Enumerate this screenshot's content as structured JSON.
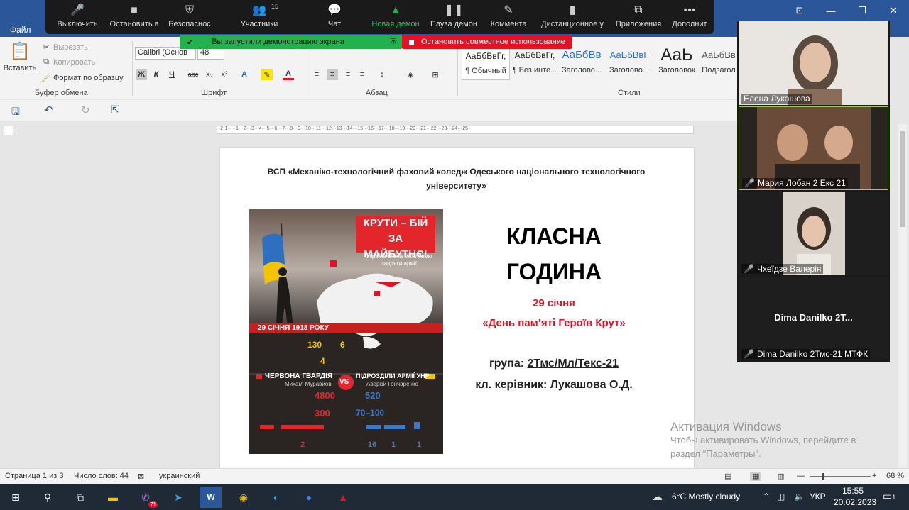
{
  "ribbon": {
    "file_tab": "Файл",
    "clipboard": {
      "paste": "Вставить",
      "cut": "Вырезать",
      "copy": "Копировать",
      "format_painter": "Формат по образцу",
      "label": "Буфер обмена"
    },
    "font": {
      "name": "Calibri (Основ",
      "size": "48",
      "label": "Шрифт",
      "bold": "Ж",
      "italic": "К",
      "underline": "Ч",
      "strike": "abc",
      "sub": "x₂",
      "sup": "x²"
    },
    "paragraph": {
      "label": "Абзац"
    },
    "styles": {
      "label": "Стили",
      "items": [
        {
          "preview": "АаБбВвГг,",
          "name": "¶ Обычный"
        },
        {
          "preview": "АаБбВвГг,",
          "name": "¶ Без инте..."
        },
        {
          "preview": "АаБбВв",
          "name": "Заголово..."
        },
        {
          "preview": "АаБбВвГ",
          "name": "Заголово..."
        },
        {
          "preview": "АаЬ",
          "name": "Заголовок"
        },
        {
          "preview": "АаБбВв",
          "name": "Подзагол"
        }
      ]
    }
  },
  "zoom": {
    "toolbar": [
      {
        "icon": "mic-icon",
        "glyph": "🎤",
        "label": "Выключить"
      },
      {
        "icon": "video-icon",
        "glyph": "■",
        "label": "Остановить в"
      },
      {
        "icon": "shield-icon",
        "glyph": "⛨",
        "label": "Безопаснос"
      },
      {
        "icon": "participants-icon",
        "glyph": "👥",
        "label": "Участники",
        "count": "15"
      },
      {
        "icon": "chat-icon",
        "glyph": "💬",
        "label": "Чат"
      },
      {
        "icon": "share-icon",
        "glyph": "▲",
        "label": "Новая демон"
      },
      {
        "icon": "pause-icon",
        "glyph": "❚❚",
        "label": "Пауза демон"
      },
      {
        "icon": "pen-icon",
        "glyph": "✎",
        "label": "Коммента"
      },
      {
        "icon": "remote-icon",
        "glyph": "▮",
        "label": "Дистанционное у"
      },
      {
        "icon": "apps-icon",
        "glyph": "⧉",
        "label": "Приложения"
      },
      {
        "icon": "more-icon",
        "glyph": "•••",
        "label": "Дополнит"
      }
    ],
    "share_notice": "Вы запустили демонстрацию экрана",
    "stop_share": "Остановить совместное использование",
    "participants": [
      {
        "name": "Елена Лукашова",
        "muted": false
      },
      {
        "name": "Мария Лобан 2 Екс 21",
        "muted": true
      },
      {
        "name": "Чхеїдзе Валерія",
        "muted": true
      },
      {
        "name": "Dima Danilko 2Тмс-21 МТФК",
        "muted": true,
        "center": "Dima Danilko 2T..."
      }
    ]
  },
  "document": {
    "header": "ВСП «Механіко-технологічний фаховий коледж Одеського національного технологічного університету»",
    "title_line1": "КЛАСНА",
    "title_line2": "ГОДИНА",
    "date": "29 січня",
    "event": "«День пам’яті Героїв Крут»",
    "group_label": "група:",
    "group_value": "2Тмс/Мл/Текс-21",
    "curator_label": "кл. керівник:",
    "curator_value": "Лукашова О.Д.",
    "infographic": {
      "headline1": "КРУТИ – БІЙ",
      "headline2": "ЗА МАЙБУТНЄ!",
      "sub": "Україна стала можливою завдяки армії",
      "date_band": "29 СІЧНЯ 1918 РОКУ",
      "km": "130",
      "hours": "6",
      "days": "4",
      "red_side": "ЧЕРВОНА ГВАРДІЯ",
      "red_cmd": "Михаїл Муравйов",
      "vs": "VS",
      "ua_side": "ПІДРОЗДІЛИ АРМІЇ УНР",
      "ua_cmd": "Аверкій Гончаренко",
      "red_troops": "4800",
      "red_lost": "300",
      "ua_troops": "520",
      "ua_lost": "70–100",
      "red_arm": "2",
      "ua_arm1": "16",
      "ua_arm2": "1",
      "ua_arm3": "1"
    }
  },
  "watermark": {
    "line1": "Активация Windows",
    "line2": "Чтобы активировать Windows, перейдите в",
    "line3": "раздел \"Параметры\"."
  },
  "statusbar": {
    "page": "Страница 1 из 3",
    "words": "Число слов: 44",
    "lang": "украинский",
    "zoom": "68 %"
  },
  "taskbar": {
    "weather": "6°C  Mostly cloudy",
    "lang": "УКР",
    "time": "15:55",
    "date": "20.02.2023",
    "badge": "71",
    "notif": "1"
  }
}
